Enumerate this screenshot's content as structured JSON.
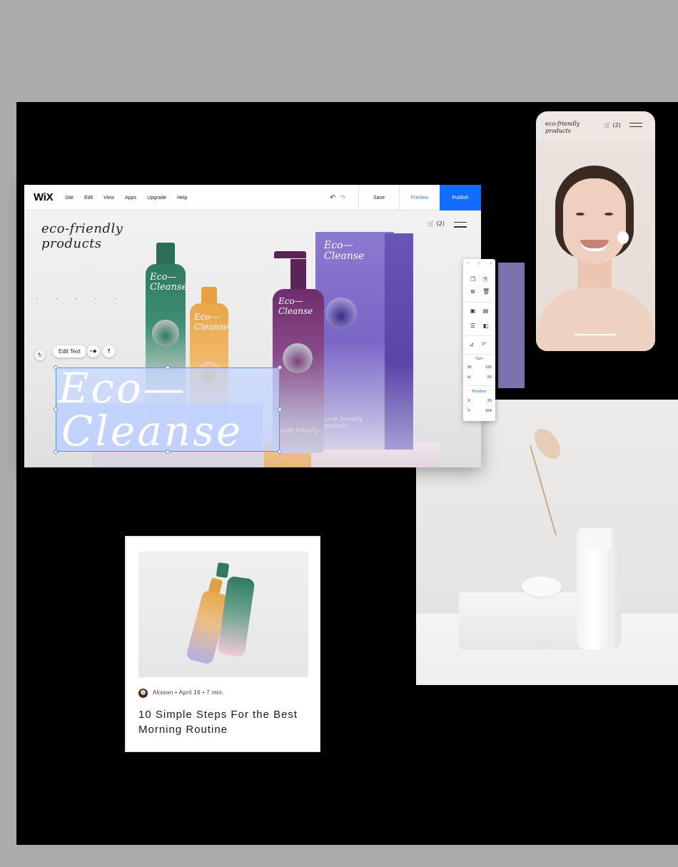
{
  "editor": {
    "logo": "WiX",
    "menu": [
      "Site",
      "Edit",
      "View",
      "Apps",
      "Upgrade",
      "Help"
    ],
    "undo_icon": "↶",
    "redo_icon": "↷",
    "save_label": "Save",
    "preview_label": "Preview",
    "publish_label": "Publish",
    "accent_color": "#116dff"
  },
  "site": {
    "brand_line1": "eco-friendly",
    "brand_line2": "products",
    "cart": "🛒 (2)",
    "hero_line1": "Eco—",
    "hero_line2": "Cleanse",
    "dots": "• • • • •"
  },
  "products": {
    "green_label": "Eco—\nCleanse",
    "orange_label": "Eco—\nCleanse",
    "purple_label": "Eco—\nCleanse",
    "box_label": "Eco—\nCleanse",
    "box_footer": "earth friendly products",
    "bottle_footer": "earth friendly"
  },
  "text_toolbar": {
    "edit_text": "Edit Text",
    "animation_icon": "«◆",
    "help_icon": "?",
    "rotate_icon": "↻"
  },
  "tool_panel": {
    "size_header": "Size",
    "w_label": "W:",
    "w_value": "120",
    "h_label": "H:",
    "h_value": "50",
    "position_header": "Position",
    "x_label": "X:",
    "x_value": "20",
    "y_label": "Y:",
    "y_value": "164",
    "rotation_value": "0°"
  },
  "mobile": {
    "brand_line1": "eco-friendly",
    "brand_line2": "products",
    "cart": "🛒 (2)"
  },
  "blog": {
    "author": "Alisson",
    "date": "April 16",
    "read_time": "7 min.",
    "title": "10 Simple Steps For the Best Morning Routine"
  }
}
